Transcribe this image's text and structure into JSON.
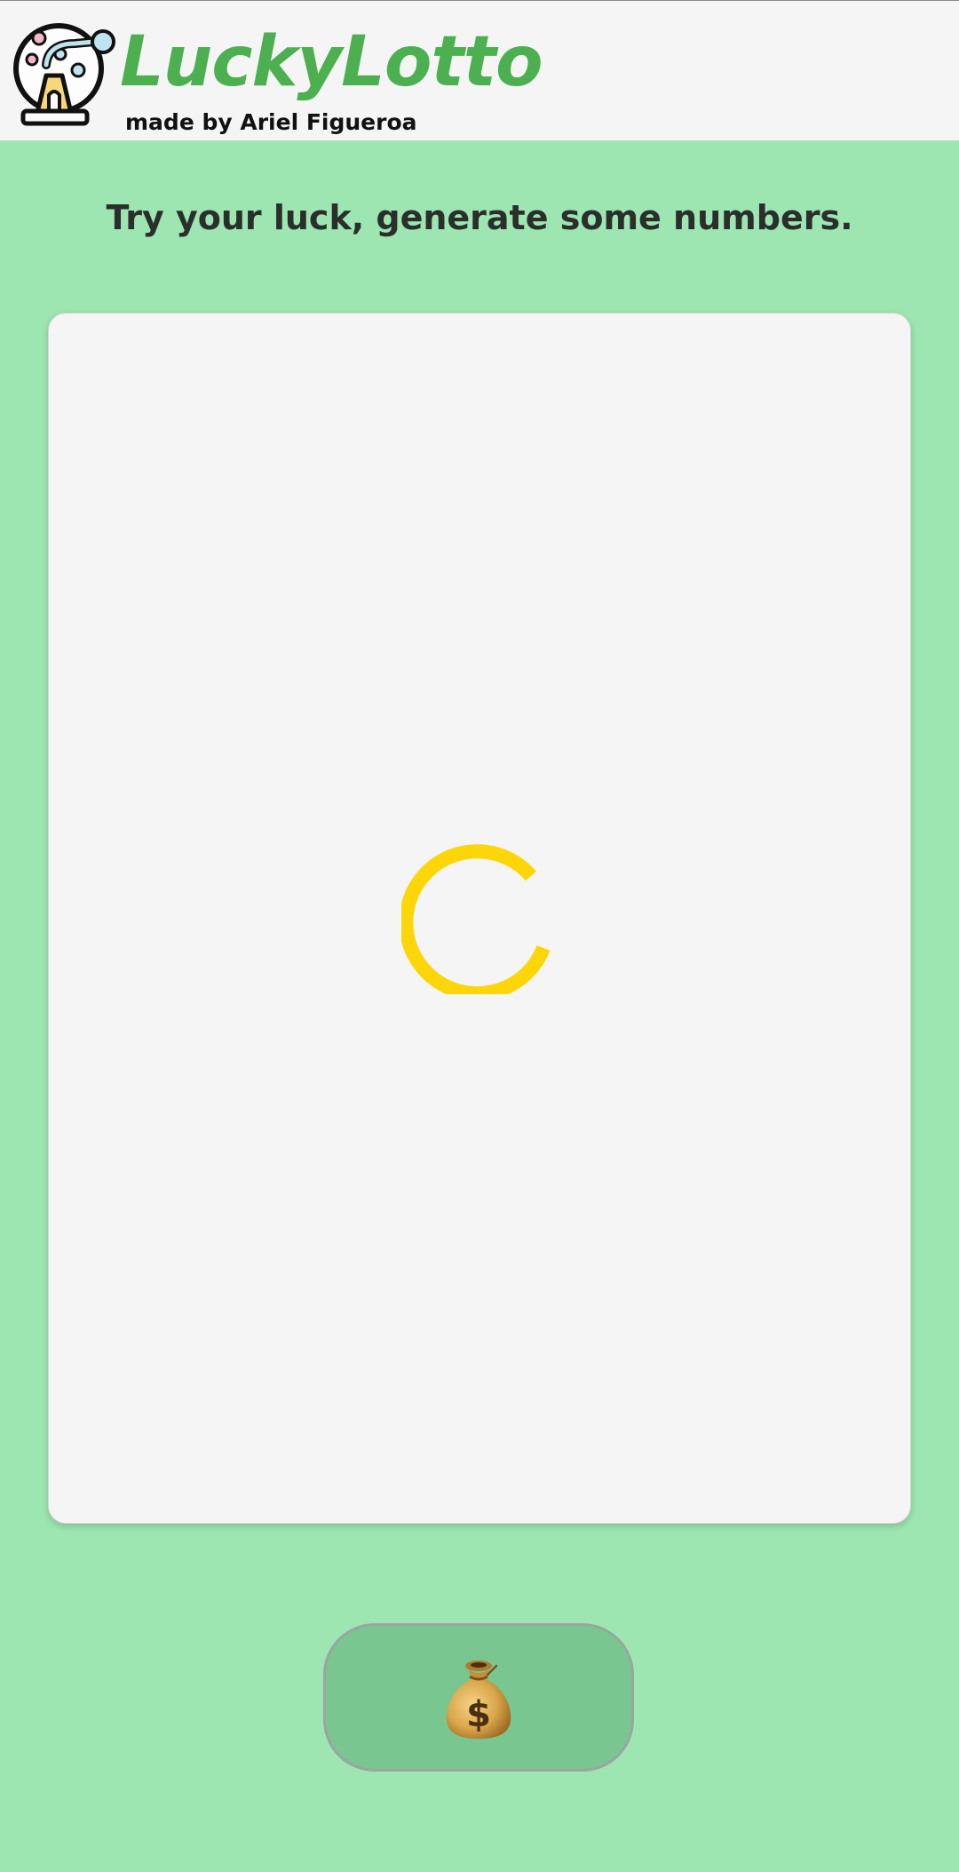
{
  "header": {
    "logo_icon": "lottery-machine-icon",
    "title": "LuckyLotto",
    "subtitle": "made by Ariel Figueroa"
  },
  "main": {
    "headline": "Try your luck, generate some numbers.",
    "card": {
      "state": "loading",
      "spinner_icon": "loading-spinner-icon"
    },
    "generate_button": {
      "icon": "money-bag-icon"
    }
  },
  "colors": {
    "background": "#9de6b1",
    "header_background": "#f5f5f5",
    "brand": "#4caf50",
    "card": "#f5f5f5",
    "spinner": "#fdd60a",
    "button": "#79c690",
    "button_border": "#9aa69e",
    "headline_text": "#2b2f2c"
  }
}
